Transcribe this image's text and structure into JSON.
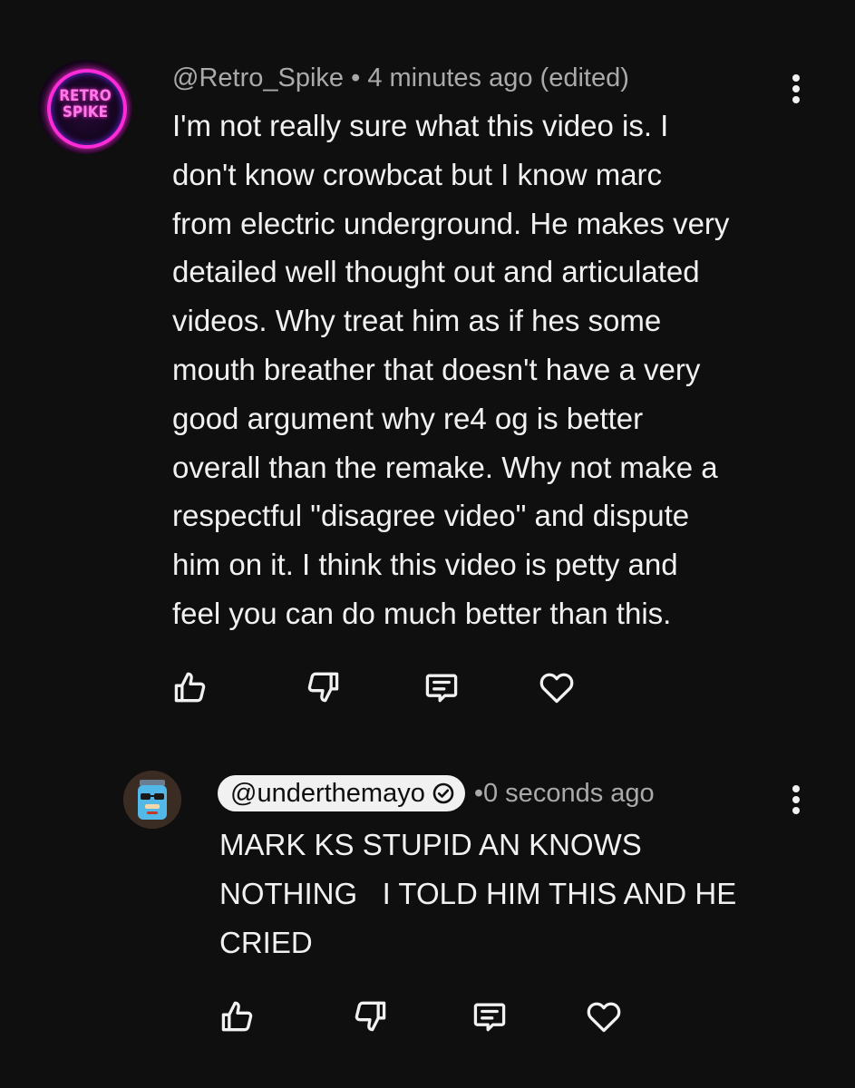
{
  "comments": [
    {
      "handle": "@Retro_Spike",
      "time": "4 minutes ago (edited)",
      "avatar_text": "RETRO\nSPIKE",
      "text": "I'm not really sure what this video is. I\ndon't know crowbcat but I know marc\nfrom electric underground. He makes very\ndetailed well thought out and articulated\nvideos. Why treat him as if hes some\nmouth breather that doesn't have a very\ngood argument why re4 og is better\noverall than the remake. Why not make a\nrespectful \"disagree video\" and dispute\nhim on it. I think this video is petty and\nfeel you can do much better than this."
    },
    {
      "handle": "@underthemayo",
      "verified": true,
      "time": "0 seconds ago",
      "text": "MARK KS STUPID AN KNOWS\nNOTHING   I TOLD HIM THIS AND HE\nCRIED"
    }
  ],
  "actions": [
    "like-icon",
    "dislike-icon",
    "reply-icon",
    "heart-icon"
  ],
  "colors": {
    "background": "#0f0f0f",
    "text": "#f1f1f1",
    "meta": "#aaaaaa",
    "avatar_neon": "#ff2bd6"
  }
}
